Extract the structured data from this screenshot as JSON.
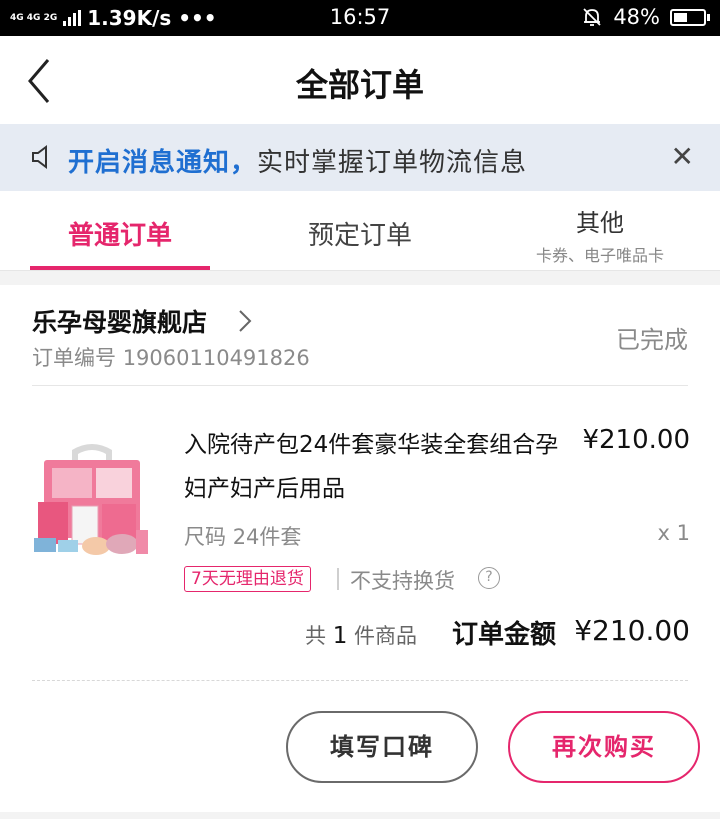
{
  "status_bar": {
    "network_labels": "4G 4G 2G",
    "speed": "1.39K/s •••",
    "time": "16:57",
    "battery": "48%",
    "battery_level": 0.48,
    "icons": [
      "signal-icon",
      "bell-mute-icon",
      "battery-icon"
    ]
  },
  "header": {
    "title": "全部订单",
    "back_icon": "chevron-left-icon"
  },
  "notice": {
    "highlight": "开启消息通知，",
    "text": "实时掌握订单物流信息",
    "close_label": "✕",
    "highlight_color": "#1f6fd1"
  },
  "tabs": [
    {
      "label": "普通订单",
      "sub": "",
      "active": true
    },
    {
      "label": "预定订单",
      "sub": "",
      "active": false
    },
    {
      "label": "其他",
      "sub": "卡券、电子唯品卡",
      "active": false
    }
  ],
  "order": {
    "shop_name": "乐孕母婴旗舰店",
    "order_no_label": "订单编号",
    "order_no": "19060110491826",
    "status": "已完成",
    "product": {
      "title": "入院待产包24件套豪华装全套组合孕妇产妇产后用品",
      "price": "¥210.00",
      "spec_label": "尺码",
      "spec_value": "24件套",
      "qty": "x 1"
    },
    "tags": {
      "return_policy": "7天无理由退货",
      "exchange": "不支持换货",
      "help": "?"
    },
    "summary": {
      "count_prefix": "共",
      "count": "1",
      "count_suffix": "件商品",
      "total_label": "订单金额",
      "total_value": "¥210.00"
    },
    "actions": {
      "review": "填写口碑",
      "rebuy": "再次购买"
    }
  },
  "colors": {
    "accent": "#e5266c",
    "notice_bg": "#e6ebf3"
  }
}
